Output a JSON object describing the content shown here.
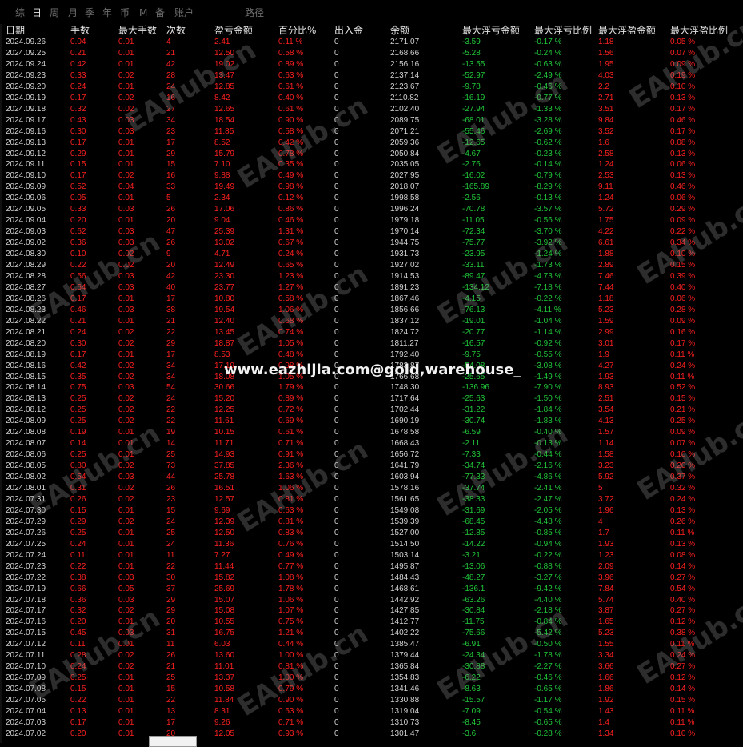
{
  "tabs": [
    "综",
    "日",
    "周",
    "月",
    "季",
    "年",
    "币",
    "M",
    "备",
    "账户",
    "路径"
  ],
  "headers": [
    "日期",
    "手数",
    "最大手数",
    "次数",
    "盈亏金额",
    "百分比%",
    "出入金",
    "余额",
    "最大浮亏金额",
    "最大浮亏比例",
    "最大浮盈金额",
    "最大浮盈比例"
  ],
  "overlay_text": "www.eazhijia.com@gold,warehouse_",
  "watermark": "EAHub.cn",
  "rows": [
    [
      "2024.09.26",
      "0.04",
      "0.01",
      "4",
      "2.41",
      "0.11 %",
      "0",
      "2171.07",
      "-3.59",
      "-0.17 %",
      "1.18",
      "0.05 %"
    ],
    [
      "2024.09.25",
      "0.21",
      "0.01",
      "21",
      "12.50",
      "0.58 %",
      "0",
      "2168.66",
      "-5.28",
      "-0.24 %",
      "1.56",
      "0.07 %"
    ],
    [
      "2024.09.24",
      "0.42",
      "0.01",
      "42",
      "19.02",
      "0.89 %",
      "0",
      "2156.16",
      "-13.55",
      "-0.63 %",
      "1.95",
      "0.09 %"
    ],
    [
      "2024.09.23",
      "0.33",
      "0.02",
      "28",
      "13.47",
      "0.63 %",
      "0",
      "2137.14",
      "-52.97",
      "-2.49 %",
      "4.03",
      "0.19 %"
    ],
    [
      "2024.09.20",
      "0.24",
      "0.01",
      "24",
      "12.85",
      "0.61 %",
      "0",
      "2123.67",
      "-9.78",
      "-0.46 %",
      "2.2",
      "0.10 %"
    ],
    [
      "2024.09.19",
      "0.17",
      "0.02",
      "16",
      "8.42",
      "0.40 %",
      "0",
      "2110.82",
      "-16.19",
      "-0.77 %",
      "2.71",
      "0.13 %"
    ],
    [
      "2024.09.18",
      "0.32",
      "0.02",
      "27",
      "12.65",
      "0.61 %",
      "0",
      "2102.40",
      "-27.94",
      "-1.33 %",
      "3.51",
      "0.17 %"
    ],
    [
      "2024.09.17",
      "0.43",
      "0.03",
      "34",
      "18.54",
      "0.90 %",
      "0",
      "2089.75",
      "-68.01",
      "-3.28 %",
      "9.84",
      "0.46 %"
    ],
    [
      "2024.09.16",
      "0.30",
      "0.03",
      "23",
      "11.85",
      "0.58 %",
      "0",
      "2071.21",
      "-55.46",
      "-2.69 %",
      "3.52",
      "0.17 %"
    ],
    [
      "2024.09.13",
      "0.17",
      "0.01",
      "17",
      "8.52",
      "0.42 %",
      "0",
      "2059.36",
      "-12.65",
      "-0.62 %",
      "1.6",
      "0.08 %"
    ],
    [
      "2024.09.12",
      "0.29",
      "0.01",
      "29",
      "15.79",
      "0.78 %",
      "0",
      "2050.84",
      "-4.67",
      "-0.23 %",
      "2.58",
      "0.13 %"
    ],
    [
      "2024.09.11",
      "0.15",
      "0.01",
      "15",
      "7.10",
      "0.35 %",
      "0",
      "2035.05",
      "-2.76",
      "-0.14 %",
      "1.24",
      "0.06 %"
    ],
    [
      "2024.09.10",
      "0.17",
      "0.02",
      "16",
      "9.88",
      "0.49 %",
      "0",
      "2027.95",
      "-16.02",
      "-0.79 %",
      "2.53",
      "0.13 %"
    ],
    [
      "2024.09.09",
      "0.52",
      "0.04",
      "33",
      "19.49",
      "0.98 %",
      "0",
      "2018.07",
      "-165.89",
      "-8.29 %",
      "9.11",
      "0.46 %"
    ],
    [
      "2024.09.06",
      "0.05",
      "0.01",
      "5",
      "2.34",
      "0.12 %",
      "0",
      "1998.58",
      "-2.56",
      "-0.13 %",
      "1.24",
      "0.06 %"
    ],
    [
      "2024.09.05",
      "0.33",
      "0.03",
      "26",
      "17.06",
      "0.86 %",
      "0",
      "1996.24",
      "-70.78",
      "-3.57 %",
      "5.72",
      "0.29 %"
    ],
    [
      "2024.09.04",
      "0.20",
      "0.01",
      "20",
      "9.04",
      "0.46 %",
      "0",
      "1979.18",
      "-11.05",
      "-0.56 %",
      "1.75",
      "0.09 %"
    ],
    [
      "2024.09.03",
      "0.62",
      "0.03",
      "47",
      "25.39",
      "1.31 %",
      "0",
      "1970.14",
      "-72.34",
      "-3.70 %",
      "4.22",
      "0.22 %"
    ],
    [
      "2024.09.02",
      "0.36",
      "0.03",
      "26",
      "13.02",
      "0.67 %",
      "0",
      "1944.75",
      "-75.77",
      "-3.92 %",
      "6.61",
      "0.34 %"
    ],
    [
      "2024.08.30",
      "0.10",
      "0.02",
      "9",
      "4.71",
      "0.24 %",
      "0",
      "1931.73",
      "-23.95",
      "-1.24 %",
      "1.88",
      "0.10 %"
    ],
    [
      "2024.08.29",
      "0.22",
      "0.02",
      "20",
      "12.49",
      "0.65 %",
      "0",
      "1927.02",
      "-33.11",
      "-1.73 %",
      "2.89",
      "0.15 %"
    ],
    [
      "2024.08.28",
      "0.56",
      "0.03",
      "42",
      "23.30",
      "1.23 %",
      "0",
      "1914.53",
      "-89.47",
      "-4.73 %",
      "7.46",
      "0.39 %"
    ],
    [
      "2024.08.27",
      "0.64",
      "0.03",
      "40",
      "23.77",
      "1.27 %",
      "0",
      "1891.23",
      "-134.12",
      "-7.18 %",
      "7.44",
      "0.40 %"
    ],
    [
      "2024.08.26",
      "0.17",
      "0.01",
      "17",
      "10.80",
      "0.58 %",
      "0",
      "1867.46",
      "-4.15",
      "-0.22 %",
      "1.18",
      "0.06 %"
    ],
    [
      "2024.08.23",
      "0.46",
      "0.03",
      "38",
      "19.54",
      "1.06 %",
      "0",
      "1856.66",
      "-76.13",
      "-4.11 %",
      "5.23",
      "0.28 %"
    ],
    [
      "2024.08.22",
      "0.21",
      "0.01",
      "21",
      "12.40",
      "0.68 %",
      "0",
      "1837.12",
      "-19.01",
      "-1.04 %",
      "1.59",
      "0.09 %"
    ],
    [
      "2024.08.21",
      "0.24",
      "0.02",
      "22",
      "13.45",
      "0.74 %",
      "0",
      "1824.72",
      "-20.77",
      "-1.14 %",
      "2.99",
      "0.16 %"
    ],
    [
      "2024.08.20",
      "0.30",
      "0.02",
      "29",
      "18.87",
      "1.05 %",
      "0",
      "1811.27",
      "-16.57",
      "-0.92 %",
      "3.01",
      "0.17 %"
    ],
    [
      "2024.08.19",
      "0.17",
      "0.01",
      "17",
      "8.53",
      "0.48 %",
      "0",
      "1792.40",
      "-9.75",
      "-0.55 %",
      "1.9",
      "0.11 %"
    ],
    [
      "2024.08.16",
      "0.42",
      "0.02",
      "34",
      "17.19",
      "0.98 %",
      "0",
      "1783.87",
      "-54.08",
      "-3.08 %",
      "4.27",
      "0.24 %"
    ],
    [
      "2024.08.15",
      "0.35",
      "0.02",
      "34",
      "18.08",
      "1.05 %",
      "0",
      "1766.68",
      "-25.65",
      "-1.49 %",
      "1.93",
      "0.11 %"
    ],
    [
      "2024.08.14",
      "0.75",
      "0.03",
      "54",
      "30.66",
      "1.79 %",
      "0",
      "1748.30",
      "-136.96",
      "-7.90 %",
      "8.93",
      "0.52 %"
    ],
    [
      "2024.08.13",
      "0.25",
      "0.02",
      "24",
      "15.20",
      "0.89 %",
      "0",
      "1717.64",
      "-25.63",
      "-1.50 %",
      "2.51",
      "0.15 %"
    ],
    [
      "2024.08.12",
      "0.25",
      "0.02",
      "22",
      "12.25",
      "0.72 %",
      "0",
      "1702.44",
      "-31.22",
      "-1.84 %",
      "3.54",
      "0.21 %"
    ],
    [
      "2024.08.09",
      "0.25",
      "0.02",
      "22",
      "11.61",
      "0.69 %",
      "0",
      "1690.19",
      "-30.74",
      "-1.83 %",
      "4.13",
      "0.25 %"
    ],
    [
      "2024.08.08",
      "0.19",
      "0.01",
      "19",
      "10.15",
      "0.61 %",
      "0",
      "1678.58",
      "-6.59",
      "-0.40 %",
      "1.57",
      "0.09 %"
    ],
    [
      "2024.08.07",
      "0.14",
      "0.01",
      "14",
      "11.71",
      "0.71 %",
      "0",
      "1668.43",
      "-2.11",
      "-0.13 %",
      "1.14",
      "0.07 %"
    ],
    [
      "2024.08.06",
      "0.25",
      "0.01",
      "25",
      "14.93",
      "0.91 %",
      "0",
      "1656.72",
      "-7.33",
      "-0.44 %",
      "1.58",
      "0.10 %"
    ],
    [
      "2024.08.05",
      "0.80",
      "0.02",
      "73",
      "37.85",
      "2.36 %",
      "0",
      "1641.79",
      "-34.74",
      "-2.16 %",
      "3.23",
      "0.20 %"
    ],
    [
      "2024.08.02",
      "0.54",
      "0.03",
      "44",
      "25.78",
      "1.63 %",
      "0",
      "1603.94",
      "-77.33",
      "-4.86 %",
      "5.92",
      "0.37 %"
    ],
    [
      "2024.08.01",
      "0.31",
      "0.02",
      "26",
      "16.51",
      "1.06 %",
      "0",
      "1578.16",
      "-37.74",
      "-2.41 %",
      "5",
      "0.32 %"
    ],
    [
      "2024.07.31",
      "0.26",
      "0.02",
      "23",
      "12.57",
      "0.81 %",
      "0",
      "1561.65",
      "-38.33",
      "-2.47 %",
      "3.72",
      "0.24 %"
    ],
    [
      "2024.07.30",
      "0.15",
      "0.01",
      "15",
      "9.69",
      "0.63 %",
      "0",
      "1549.08",
      "-31.69",
      "-2.05 %",
      "1.96",
      "0.13 %"
    ],
    [
      "2024.07.29",
      "0.29",
      "0.02",
      "24",
      "12.39",
      "0.81 %",
      "0",
      "1539.39",
      "-68.45",
      "-4.48 %",
      "4",
      "0.26 %"
    ],
    [
      "2024.07.26",
      "0.25",
      "0.01",
      "25",
      "12.50",
      "0.83 %",
      "0",
      "1527.00",
      "-12.85",
      "-0.85 %",
      "1.7",
      "0.11 %"
    ],
    [
      "2024.07.25",
      "0.24",
      "0.01",
      "24",
      "11.36",
      "0.76 %",
      "0",
      "1514.50",
      "-14.22",
      "-0.94 %",
      "1.93",
      "0.13 %"
    ],
    [
      "2024.07.24",
      "0.11",
      "0.01",
      "11",
      "7.27",
      "0.49 %",
      "0",
      "1503.14",
      "-3.21",
      "-0.22 %",
      "1.23",
      "0.08 %"
    ],
    [
      "2024.07.23",
      "0.22",
      "0.01",
      "22",
      "11.44",
      "0.77 %",
      "0",
      "1495.87",
      "-13.06",
      "-0.88 %",
      "2.09",
      "0.14 %"
    ],
    [
      "2024.07.22",
      "0.38",
      "0.03",
      "30",
      "15.82",
      "1.08 %",
      "0",
      "1484.43",
      "-48.27",
      "-3.27 %",
      "3.96",
      "0.27 %"
    ],
    [
      "2024.07.19",
      "0.66",
      "0.05",
      "37",
      "25.69",
      "1.78 %",
      "0",
      "1468.61",
      "-136.1",
      "-9.42 %",
      "7.84",
      "0.54 %"
    ],
    [
      "2024.07.18",
      "0.36",
      "0.03",
      "29",
      "15.07",
      "1.06 %",
      "0",
      "1442.92",
      "-63.26",
      "-4.40 %",
      "5.74",
      "0.40 %"
    ],
    [
      "2024.07.17",
      "0.32",
      "0.02",
      "29",
      "15.08",
      "1.07 %",
      "0",
      "1427.85",
      "-30.84",
      "-2.18 %",
      "3.87",
      "0.27 %"
    ],
    [
      "2024.07.16",
      "0.20",
      "0.01",
      "20",
      "10.55",
      "0.75 %",
      "0",
      "1412.77",
      "-11.75",
      "-0.84 %",
      "1.65",
      "0.12 %"
    ],
    [
      "2024.07.15",
      "0.45",
      "0.03",
      "31",
      "16.75",
      "1.21 %",
      "0",
      "1402.22",
      "-75.66",
      "-5.42 %",
      "5.23",
      "0.38 %"
    ],
    [
      "2024.07.12",
      "0.11",
      "0.01",
      "11",
      "6.03",
      "0.44 %",
      "0",
      "1385.47",
      "-6.91",
      "-0.50 %",
      "1.55",
      "0.11 %"
    ],
    [
      "2024.07.11",
      "0.28",
      "0.02",
      "26",
      "13.60",
      "1.00 %",
      "0",
      "1379.44",
      "-24.34",
      "-1.78 %",
      "3.34",
      "0.24 %"
    ],
    [
      "2024.07.10",
      "0.24",
      "0.02",
      "21",
      "11.01",
      "0.81 %",
      "0",
      "1365.84",
      "-30.88",
      "-2.27 %",
      "3.66",
      "0.27 %"
    ],
    [
      "2024.07.09",
      "0.25",
      "0.01",
      "25",
      "13.37",
      "1.00 %",
      "0",
      "1354.83",
      "-6.22",
      "-0.46 %",
      "1.66",
      "0.12 %"
    ],
    [
      "2024.07.08",
      "0.15",
      "0.01",
      "15",
      "10.58",
      "0.79 %",
      "0",
      "1341.46",
      "-8.63",
      "-0.65 %",
      "1.86",
      "0.14 %"
    ],
    [
      "2024.07.05",
      "0.22",
      "0.01",
      "22",
      "11.84",
      "0.90 %",
      "0",
      "1330.88",
      "-15.57",
      "-1.17 %",
      "1.92",
      "0.15 %"
    ],
    [
      "2024.07.04",
      "0.13",
      "0.01",
      "13",
      "8.31",
      "0.63 %",
      "0",
      "1319.04",
      "-7.09",
      "-0.54 %",
      "1.43",
      "0.11 %"
    ],
    [
      "2024.07.03",
      "0.17",
      "0.01",
      "17",
      "9.26",
      "0.71 %",
      "0",
      "1310.73",
      "-8.45",
      "-0.65 %",
      "1.4",
      "0.11 %"
    ],
    [
      "2024.07.02",
      "0.20",
      "0.01",
      "20",
      "12.05",
      "0.93 %",
      "0",
      "1301.47",
      "-3.6",
      "-0.28 %",
      "1.34",
      "0.10 %"
    ]
  ]
}
